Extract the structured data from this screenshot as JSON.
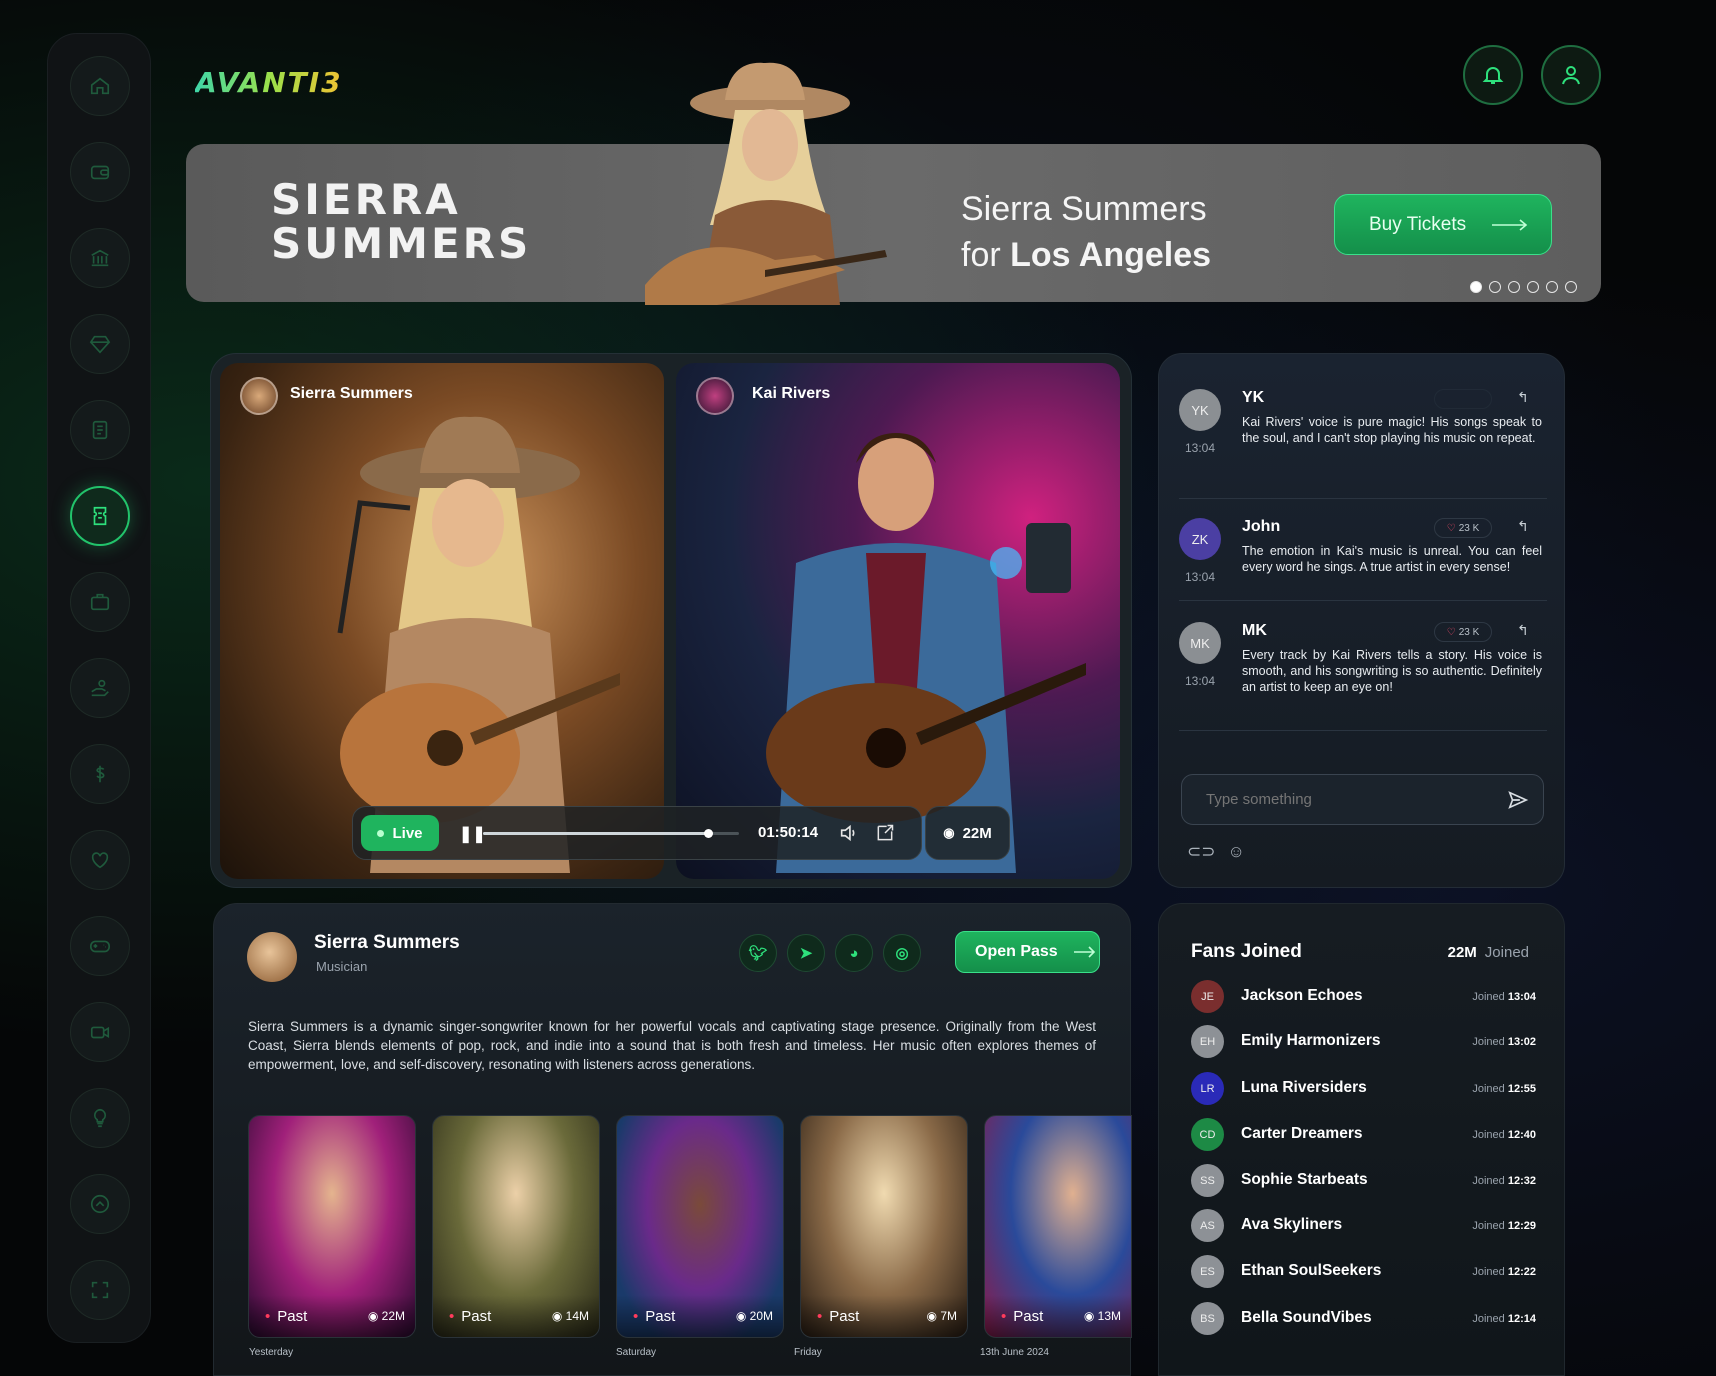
{
  "app": {
    "logo": "AVANTI3"
  },
  "sidebar": {
    "items": [
      "home-icon",
      "wallet-icon",
      "bank-icon",
      "diamond-icon",
      "receipt-icon",
      "ticket-icon",
      "briefcase-icon",
      "donate-icon",
      "dollar-icon",
      "heart-icon",
      "gamepad-icon",
      "video-icon",
      "lightbulb-icon",
      "up-arrow-icon",
      "fullscreen-icon"
    ],
    "active_index": 5
  },
  "banner": {
    "title_line1": "SIERRA",
    "title_line2": "SUMMERS",
    "sub_line1": "Sierra Summers",
    "sub_prefix": "for",
    "sub_city": "Los Angeles",
    "buy_label": "Buy Tickets",
    "slides": 6,
    "active_slide": 0
  },
  "video": {
    "left_name": "Sierra Summers",
    "right_name": "Kai Rivers",
    "live_label": "Live",
    "time": "01:50:14",
    "progress": 0.88,
    "views": "22M"
  },
  "chat": {
    "messages": [
      {
        "initials": "YK",
        "name": "YK",
        "time": "13:04",
        "likes": "",
        "text": "Kai Rivers' voice is pure magic! His songs speak to the soul, and I can't stop playing his music on repeat.",
        "color": "#8b8f93"
      },
      {
        "initials": "ZK",
        "name": "John",
        "time": "13:04",
        "likes": "23 K",
        "text": "The emotion in Kai's music is unreal. You can feel every word he sings. A true artist in every sense!",
        "color": "#4b3fa3"
      },
      {
        "initials": "MK",
        "name": "MK",
        "time": "13:04",
        "likes": "23 K",
        "text": "Every track by Kai Rivers tells a story. His voice is smooth, and his songwriting is so authentic. Definitely an artist to keep an eye on!",
        "color": "#8b8f93"
      }
    ],
    "input_placeholder": "Type something"
  },
  "profile": {
    "name": "Sierra Summers",
    "role": "Musician",
    "open_pass": "Open Pass",
    "bio": "Sierra Summers is a dynamic singer-songwriter known for her powerful vocals and captivating stage presence. Originally from the West Coast, Sierra blends elements of pop, rock, and indie into a sound that is both fresh and timeless. Her music often explores themes of empowerment, love, and self-discovery, resonating with listeners across generations.",
    "social": [
      "twitter-icon",
      "telegram-icon",
      "reddit-icon",
      "instagram-icon"
    ],
    "thumbs": [
      {
        "status": "Past",
        "views": "22M",
        "day": "Yesterday"
      },
      {
        "status": "Past",
        "views": "14M",
        "day": ""
      },
      {
        "status": "Past",
        "views": "20M",
        "day": "Saturday"
      },
      {
        "status": "Past",
        "views": "7M",
        "day": "Friday"
      },
      {
        "status": "Past",
        "views": "13M",
        "day": "13th June 2024"
      }
    ]
  },
  "fans": {
    "title": "Fans Joined",
    "count": "22M",
    "count_label": "Joined",
    "list": [
      {
        "initials": "JE",
        "name": "Jackson Echoes",
        "label": "Joined",
        "time": "13:04",
        "color": "#7a2e2e"
      },
      {
        "initials": "EH",
        "name": "Emily Harmonizers",
        "label": "Joined",
        "time": "13:02",
        "color": "#8d9196"
      },
      {
        "initials": "LR",
        "name": "Luna Riversiders",
        "label": "Joined",
        "time": "12:55",
        "color": "#2a2ab8"
      },
      {
        "initials": "CD",
        "name": "Carter Dreamers",
        "label": "Joined",
        "time": "12:40",
        "color": "#1d8a45"
      },
      {
        "initials": "SS",
        "name": "Sophie Starbeats",
        "label": "Joined",
        "time": "12:32",
        "color": "#8d9196"
      },
      {
        "initials": "AS",
        "name": "Ava Skyliners",
        "label": "Joined",
        "time": "12:29",
        "color": "#8d9196"
      },
      {
        "initials": "ES",
        "name": "Ethan SoulSeekers",
        "label": "Joined",
        "time": "12:22",
        "color": "#8d9196"
      },
      {
        "initials": "BS",
        "name": "Bella SoundVibes",
        "label": "Joined",
        "time": "12:14",
        "color": "#8d9196"
      }
    ]
  }
}
